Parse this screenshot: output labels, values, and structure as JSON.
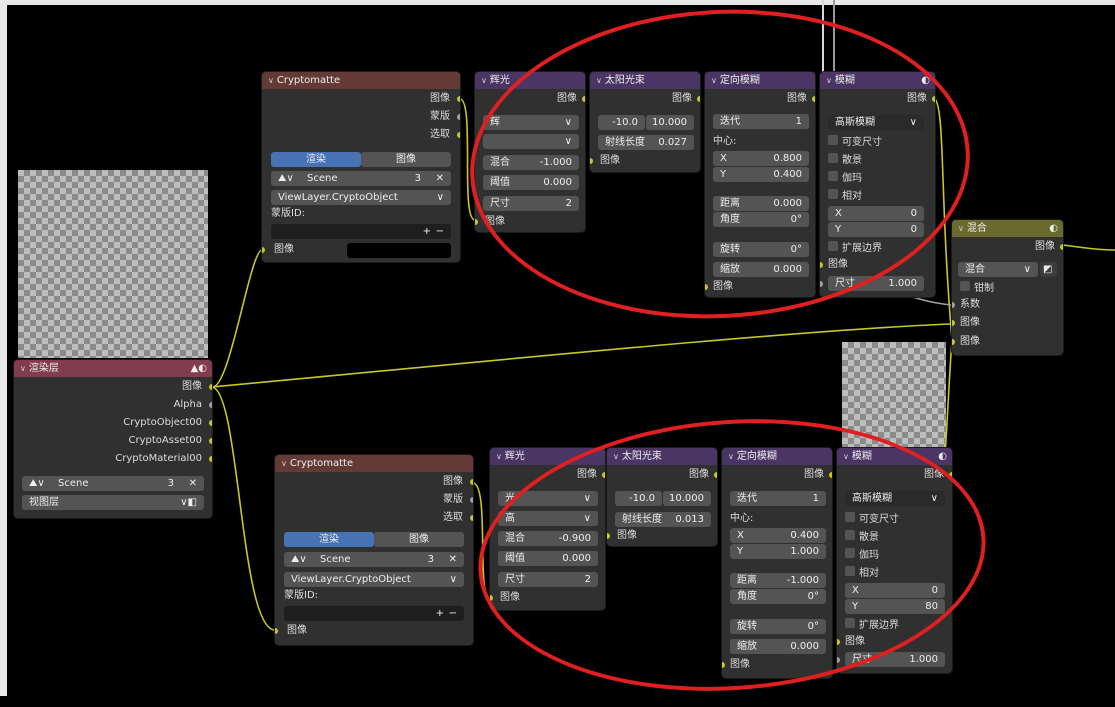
{
  "colors": {
    "socket_color": "#c7c729",
    "socket_data": "#a1a1a1",
    "annotation": "#e02020",
    "tab_active": "#4772b3"
  },
  "cm1": {
    "title": "Cryptomatte",
    "out_image": "图像",
    "out_matte": "蒙版",
    "out_pick": "选取",
    "tab_render": "渲染",
    "tab_image": "图像",
    "scene": "Scene",
    "scene_users": "3",
    "layer": "ViewLayer.CryptoObject",
    "matte_id_label": "蒙版ID:",
    "in_image": "图像"
  },
  "glare1": {
    "title": "辉光",
    "out_image": "图像",
    "type": "辉",
    "quality": "",
    "mix_label": "混合",
    "mix": "-1.000",
    "threshold_label": "阈值",
    "threshold": "0.000",
    "size_label": "尺寸",
    "size": "2",
    "in_image": "图像"
  },
  "sunbeam1": {
    "title": "太阳光束",
    "out_image": "图像",
    "src_x": "-10.0",
    "src_y": "10.000",
    "ray_label": "射线长度",
    "ray": "0.027",
    "in_image": "图像"
  },
  "dblur1": {
    "title": "定向模糊",
    "out_image": "图像",
    "iter_label": "迭代",
    "iter": "1",
    "center_label": "中心:",
    "x_label": "X",
    "x": "0.800",
    "y_label": "Y",
    "y": "0.400",
    "dist_label": "距离",
    "dist": "0.000",
    "angle_label": "角度",
    "angle": "0°",
    "spin_label": "旋转",
    "spin": "0°",
    "zoom_label": "缩放",
    "zoom": "0.000",
    "in_image": "图像"
  },
  "blur1": {
    "title": "模糊",
    "out_image": "图像",
    "type": "高斯模糊",
    "variable": "可变尺寸",
    "bokeh": "散景",
    "gamma": "伽玛",
    "relative": "相对",
    "x_label": "X",
    "x": "0",
    "y_label": "Y",
    "y": "0",
    "extend": "扩展边界",
    "in_image": "图像",
    "size_label": "尺寸",
    "size": "1.000"
  },
  "mix": {
    "title": "混合",
    "out_image": "图像",
    "mode": "混合",
    "clamp": "钳制",
    "fac": "系数",
    "in_image1": "图像",
    "in_image2": "图像"
  },
  "render": {
    "title": "渲染层",
    "out_image": "图像",
    "out_alpha": "Alpha",
    "out_obj": "CryptoObject00",
    "out_asset": "CryptoAsset00",
    "out_mat": "CryptoMaterial00",
    "scene": "Scene",
    "scene_users": "3",
    "layer": "视图层"
  },
  "cm2": {
    "title": "Cryptomatte",
    "out_image": "图像",
    "out_matte": "蒙版",
    "out_pick": "选取",
    "tab_render": "渲染",
    "tab_image": "图像",
    "scene": "Scene",
    "scene_users": "3",
    "layer": "ViewLayer.CryptoObject",
    "matte_id_label": "蒙版ID:",
    "in_image": "图像"
  },
  "glare2": {
    "title": "辉光",
    "out_image": "图像",
    "type": "光",
    "quality": "高",
    "mix_label": "混合",
    "mix": "-0.900",
    "threshold_label": "阈值",
    "threshold": "0.000",
    "size_label": "尺寸",
    "size": "2",
    "in_image": "图像"
  },
  "sunbeam2": {
    "title": "太阳光束",
    "out_image": "图像",
    "src_x": "-10.0",
    "src_y": "10.000",
    "ray_label": "射线长度",
    "ray": "0.013",
    "in_image": "图像"
  },
  "dblur2": {
    "title": "定向模糊",
    "out_image": "图像",
    "iter_label": "迭代",
    "iter": "1",
    "center_label": "中心:",
    "x_label": "X",
    "x": "0.400",
    "y_label": "Y",
    "y": "1.000",
    "dist_label": "距离",
    "dist": "-1.000",
    "angle_label": "角度",
    "angle": "0°",
    "spin_label": "旋转",
    "spin": "0°",
    "zoom_label": "缩放",
    "zoom": "0.000",
    "in_image": "图像"
  },
  "blur2": {
    "title": "模糊",
    "out_image": "图像",
    "type": "高斯模糊",
    "variable": "可变尺寸",
    "bokeh": "散景",
    "gamma": "伽玛",
    "relative": "相对",
    "x_label": "X",
    "x": "0",
    "y_label": "Y",
    "y": "80",
    "extend": "扩展边界",
    "in_image": "图像",
    "size_label": "尺寸",
    "size": "1.000"
  },
  "icons": {
    "dropdown": "chevron-down-icon",
    "close": "close-icon",
    "add": "plus-icon",
    "remove": "minus-icon",
    "warning": "warning-icon",
    "sphere": "sphere-icon"
  }
}
